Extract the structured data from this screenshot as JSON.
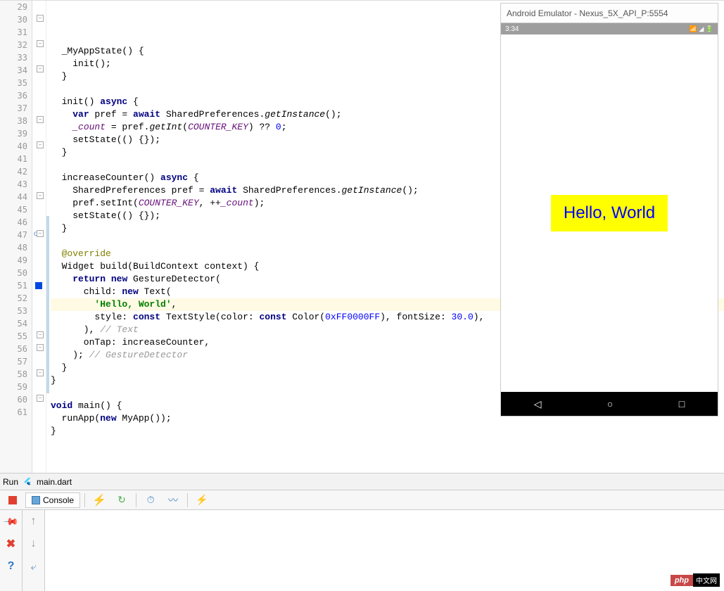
{
  "emulator": {
    "title": "Android Emulator - Nexus_5X_API_P:5554",
    "clock": "3:34",
    "hello": "Hello, World"
  },
  "run_tab": {
    "label": "Run",
    "config": "main.dart"
  },
  "console": {
    "tab": "Console"
  },
  "badge": {
    "php": "php",
    "cn": "中文网"
  },
  "code": {
    "lines": [
      {
        "n": 29,
        "t": ""
      },
      {
        "n": 30,
        "t": "  _MyAppState() {",
        "fold": true
      },
      {
        "n": 31,
        "t": "    init();"
      },
      {
        "n": 32,
        "t": "  }",
        "fold_end": true
      },
      {
        "n": 33,
        "t": ""
      },
      {
        "n": 34,
        "t": "  init() async {",
        "fold": true
      },
      {
        "n": 35,
        "t": "    var pref = await SharedPreferences.getInstance();"
      },
      {
        "n": 36,
        "t": "    _count = pref.getInt(COUNTER_KEY) ?? 0;"
      },
      {
        "n": 37,
        "t": "    setState(() {});"
      },
      {
        "n": 38,
        "t": "  }",
        "fold_end": true
      },
      {
        "n": 39,
        "t": ""
      },
      {
        "n": 40,
        "t": "  increaseCounter() async {",
        "fold": true
      },
      {
        "n": 41,
        "t": "    SharedPreferences pref = await SharedPreferences.getInstance();"
      },
      {
        "n": 42,
        "t": "    pref.setInt(COUNTER_KEY, ++_count);"
      },
      {
        "n": 43,
        "t": "    setState(() {});"
      },
      {
        "n": 44,
        "t": "  }",
        "fold_end": true
      },
      {
        "n": 45,
        "t": ""
      },
      {
        "n": 46,
        "t": "  @override"
      },
      {
        "n": 47,
        "t": "  Widget build(BuildContext context) {",
        "fold": true,
        "override": true
      },
      {
        "n": 48,
        "t": "    return new GestureDetector("
      },
      {
        "n": 49,
        "t": "      child: new Text("
      },
      {
        "n": 50,
        "t": "        'Hello, World',",
        "hl": true
      },
      {
        "n": 51,
        "t": "        style: const TextStyle(color: const Color(0xFF0000FF), fontSize: 30.0),",
        "blue": true
      },
      {
        "n": 52,
        "t": "      ), // Text"
      },
      {
        "n": 53,
        "t": "      onTap: increaseCounter,"
      },
      {
        "n": 54,
        "t": "    ); // GestureDetector"
      },
      {
        "n": 55,
        "t": "  }",
        "fold_end": true
      },
      {
        "n": 56,
        "t": "}",
        "fold_end": true
      },
      {
        "n": 57,
        "t": ""
      },
      {
        "n": 58,
        "t": "void main() {",
        "fold": true
      },
      {
        "n": 59,
        "t": "  runApp(new MyApp());"
      },
      {
        "n": 60,
        "t": "}",
        "fold_end": true
      },
      {
        "n": 61,
        "t": ""
      }
    ]
  }
}
